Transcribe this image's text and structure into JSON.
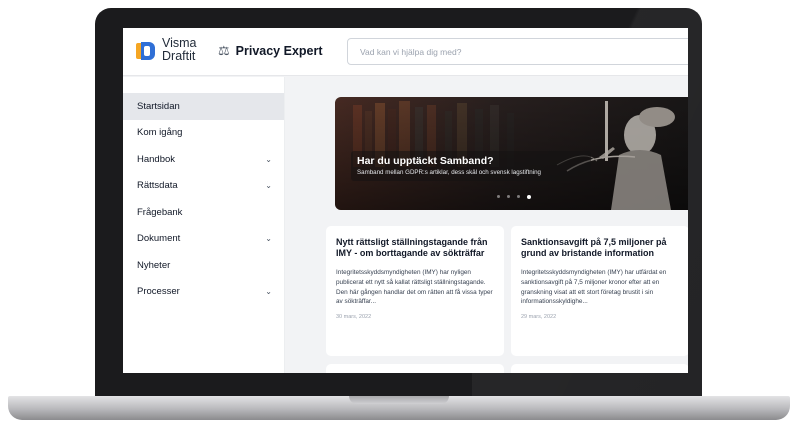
{
  "brand": {
    "name_line1": "Visma",
    "name_line2": "Draftit",
    "product_name": "Privacy Expert",
    "product_icon": "scales-icon",
    "accent_blue": "#2f6fd6",
    "accent_orange": "#f5a623"
  },
  "search": {
    "placeholder": "Vad kan vi hjälpa dig med?"
  },
  "sidebar": {
    "items": [
      {
        "label": "Startsidan",
        "active": true,
        "expandable": false
      },
      {
        "label": "Kom igång",
        "active": false,
        "expandable": false
      },
      {
        "label": "Handbok",
        "active": false,
        "expandable": true
      },
      {
        "label": "Rättsdata",
        "active": false,
        "expandable": true
      },
      {
        "label": "Frågebank",
        "active": false,
        "expandable": false
      },
      {
        "label": "Dokument",
        "active": false,
        "expandable": true
      },
      {
        "label": "Nyheter",
        "active": false,
        "expandable": false
      },
      {
        "label": "Processer",
        "active": false,
        "expandable": true
      }
    ]
  },
  "hero": {
    "title": "Har du upptäckt Samband?",
    "subtitle": "Samband mellan GDPR:s artiklar, dess skäl och svensk lagstiftning",
    "slides_total": 4,
    "slide_active": 4
  },
  "news": [
    {
      "title": "Nytt rättsligt ställningstagande från IMY - om borttagande av sökträffar",
      "body": "Integritetsskyddsmyndigheten (IMY) har nyligen publicerat ett nytt så kallat rättsligt ställningstagande. Den här gången handlar det om rätten att få vissa typer av sökträffar...",
      "date": "30 mars, 2022"
    },
    {
      "title": "Sanktionsavgift på 7,5 miljoner på grund av bristande information",
      "body": "Integritetsskyddsmyndigheten (IMY) har utfärdat en sanktionsavgift på 7,5 miljoner kronor efter att en granskning visat att ett stort företag brustit i sin informationsskyldighe...",
      "date": "29 mars, 2022"
    }
  ]
}
